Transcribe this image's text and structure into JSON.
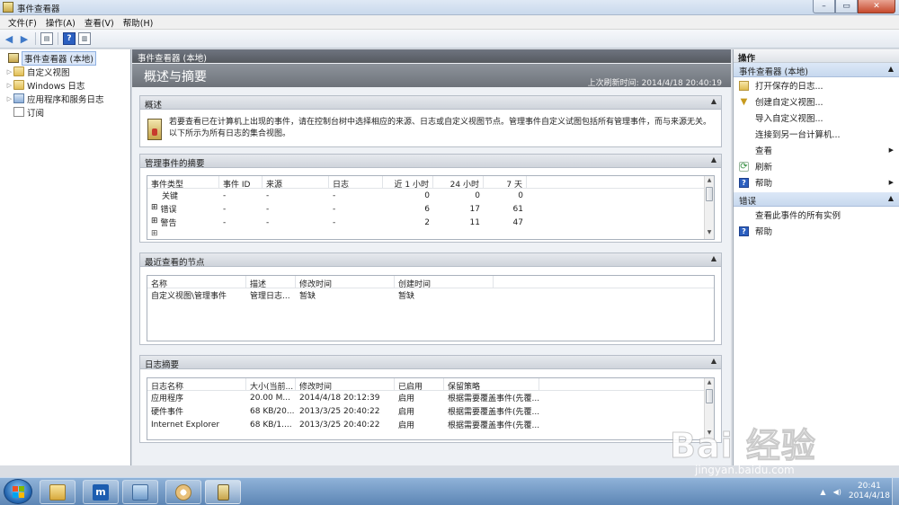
{
  "window": {
    "title": "事件查看器"
  },
  "menu": [
    "文件(F)",
    "操作(A)",
    "查看(V)",
    "帮助(H)"
  ],
  "tree": {
    "items": [
      {
        "label": "事件查看器 (本地)",
        "icon": "event-viewer-icon",
        "selected": true
      },
      {
        "label": "自定义视图",
        "icon": "folder-icon"
      },
      {
        "label": "Windows 日志",
        "icon": "folder-icon"
      },
      {
        "label": "应用程序和服务日志",
        "icon": "folder-icon"
      },
      {
        "label": "订阅",
        "icon": "subscription-icon"
      }
    ]
  },
  "center": {
    "header": "事件查看器 (本地)",
    "title": "概述与摘要",
    "refresh": "上次刷新时间: 2014/4/18 20:40:19",
    "overview": {
      "heading": "概述",
      "text": "若要查看已在计算机上出现的事件，请在控制台树中选择相应的来源、日志或自定义视图节点。管理事件自定义试图包括所有管理事件，而与来源无关。以下所示为所有日志的集合视图。"
    },
    "admin": {
      "heading": "管理事件的摘要",
      "columns": [
        "事件类型",
        "事件 ID",
        "来源",
        "日志",
        "近 1 小时",
        "24 小时",
        "7 天"
      ],
      "rows": [
        [
          "关键",
          "-",
          "-",
          "-",
          "0",
          "0",
          "0"
        ],
        [
          "错误",
          "-",
          "-",
          "-",
          "6",
          "17",
          "61"
        ],
        [
          "警告",
          "-",
          "-",
          "-",
          "2",
          "11",
          "47"
        ]
      ]
    },
    "recent": {
      "heading": "最近查看的节点",
      "columns": [
        "名称",
        "描述",
        "修改时间",
        "创建时间"
      ],
      "rows": [
        [
          "自定义视图\\管理事件",
          "管理日志...",
          "暂缺",
          "暂缺"
        ]
      ]
    },
    "logs": {
      "heading": "日志摘要",
      "columns": [
        "日志名称",
        "大小(当前...",
        "修改时间",
        "已启用",
        "保留策略"
      ],
      "rows": [
        [
          "应用程序",
          "20.00 M...",
          "2014/4/18 20:12:39",
          "启用",
          "根据需要覆盖事件(先覆..."
        ],
        [
          "硬件事件",
          "68 KB/20...",
          "2013/3/25 20:40:22",
          "启用",
          "根据需要覆盖事件(先覆..."
        ],
        [
          "Internet Explorer",
          "68 KB/1....",
          "2013/3/25 20:40:22",
          "启用",
          "根据需要覆盖事件(先覆..."
        ]
      ]
    }
  },
  "actions": {
    "title": "操作",
    "group1": "事件查看器 (本地)",
    "items1": [
      {
        "label": "打开保存的日志...",
        "icon": "open-log-icon"
      },
      {
        "label": "创建自定义视图...",
        "icon": "filter-icon"
      },
      {
        "label": "导入自定义视图...",
        "icon": ""
      },
      {
        "label": "连接到另一台计算机...",
        "icon": ""
      },
      {
        "label": "查看",
        "icon": "",
        "submenu": true
      },
      {
        "label": "刷新",
        "icon": "refresh-icon"
      },
      {
        "label": "帮助",
        "icon": "help-icon",
        "submenu": true
      }
    ],
    "group2": "错误",
    "items2": [
      {
        "label": "查看此事件的所有实例",
        "icon": ""
      },
      {
        "label": "帮助",
        "icon": "help-icon"
      }
    ]
  },
  "watermark": {
    "logo": "Bai 经验",
    "url": "jingyan.baidu.com"
  },
  "taskbar": {
    "time": "20:41",
    "date": "2014/4/18"
  }
}
